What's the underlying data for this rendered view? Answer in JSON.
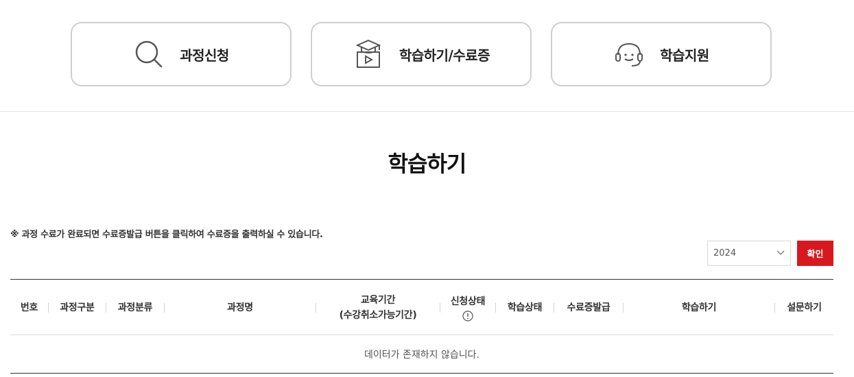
{
  "menu": {
    "items": [
      {
        "label": "과정신청",
        "icon": "search-icon"
      },
      {
        "label": "학습하기/수료증",
        "icon": "graduation-video-icon"
      },
      {
        "label": "학습지원",
        "icon": "headset-icon"
      }
    ]
  },
  "page": {
    "title": "학습하기",
    "notice": "※ 과정 수료가 완료되면 수료증발급 버튼을 클릭하여 수료증을 출력하실 수 있습니다."
  },
  "filter": {
    "year_value": "2024",
    "confirm_label": "확인"
  },
  "table": {
    "headers": {
      "no": "번호",
      "course_type": "과정구분",
      "course_category": "과정분류",
      "course_name": "과정명",
      "period_line1": "교육기간",
      "period_line2": "(수강취소가능기간)",
      "apply_status": "신청상태",
      "learn_status": "학습상태",
      "certificate": "수료증발급",
      "study": "학습하기",
      "survey": "설문하기"
    },
    "empty_message": "데이터가 존재하지 않습니다."
  },
  "colors": {
    "accent": "#d7191f",
    "card_border": "#cfcfcf"
  }
}
